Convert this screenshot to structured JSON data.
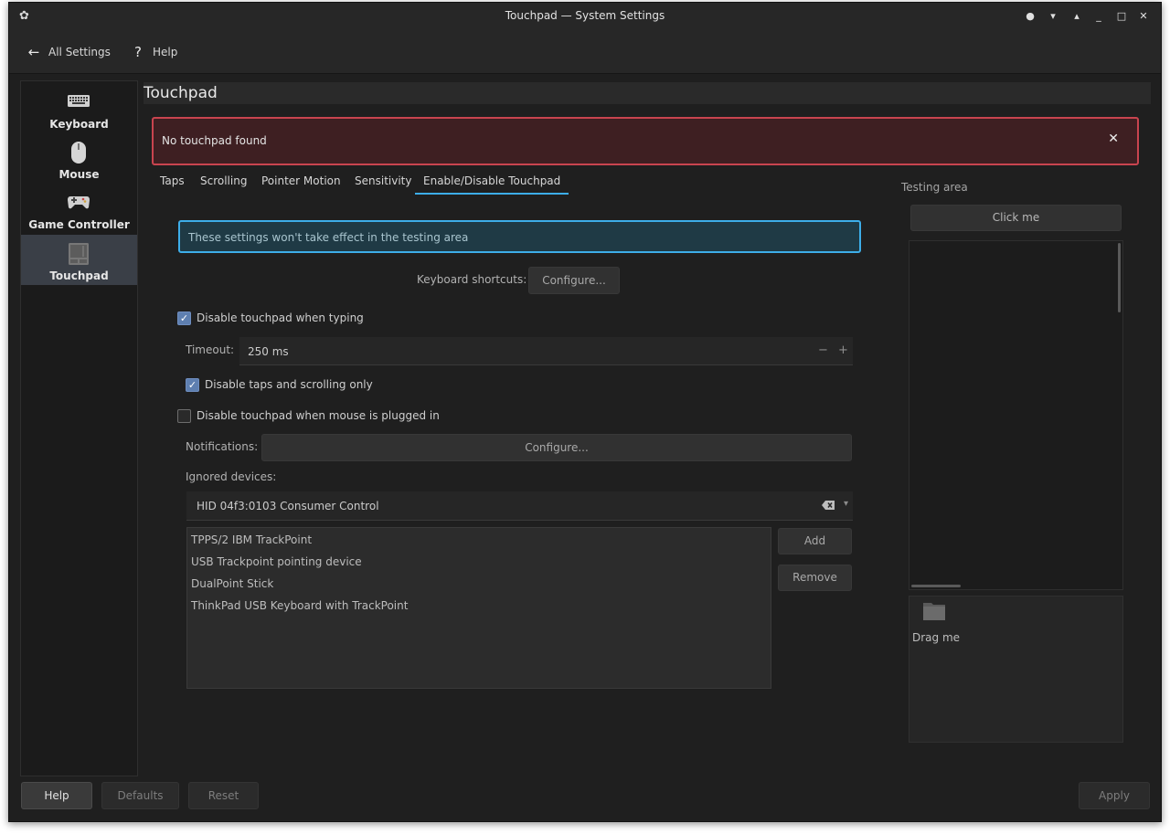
{
  "window": {
    "title": "Touchpad — System Settings",
    "controls": [
      "●",
      "▾",
      "▴",
      "_",
      "□",
      "✕"
    ]
  },
  "toolbar": {
    "back_label": "All Settings",
    "help_label": "Help"
  },
  "sidebar": {
    "items": [
      {
        "label": "Keyboard",
        "icon": "keyboard-icon"
      },
      {
        "label": "Mouse",
        "icon": "mouse-icon"
      },
      {
        "label": "Game Controller",
        "icon": "game-controller-icon"
      },
      {
        "label": "Touchpad",
        "icon": "touchpad-icon",
        "active": true
      }
    ]
  },
  "page": {
    "title": "Touchpad"
  },
  "error": {
    "message": "No touchpad found",
    "close": "✕"
  },
  "tabs": [
    {
      "label": "Taps"
    },
    {
      "label": "Scrolling"
    },
    {
      "label": "Pointer Motion"
    },
    {
      "label": "Sensitivity"
    },
    {
      "label": "Enable/Disable Touchpad",
      "active": true
    }
  ],
  "settings": {
    "info": "These settings won't take effect in the testing area",
    "keyboard_shortcuts_label": "Keyboard shortcuts:",
    "configure_label": "Configure...",
    "disable_typing_label": "Disable touchpad when typing",
    "disable_typing_checked": true,
    "timeout_label": "Timeout:",
    "timeout_value": "250 ms",
    "spin_minus": "−",
    "spin_plus": "+",
    "disable_taps_label": "Disable taps and scrolling only",
    "disable_taps_checked": true,
    "disable_mouse_label": "Disable touchpad when mouse is plugged in",
    "disable_mouse_checked": false,
    "notifications_label": "Notifications:",
    "notifications_configure": "Configure...",
    "ignored_devices_label": "Ignored devices:",
    "combo_value": "HID 04f3:0103 Consumer Control",
    "ignored_devices": [
      "TPPS/2 IBM TrackPoint",
      "USB Trackpoint pointing device",
      "DualPoint Stick",
      "ThinkPad USB Keyboard with TrackPoint"
    ],
    "add_label": "Add",
    "remove_label": "Remove"
  },
  "testing": {
    "title": "Testing area",
    "click_label": "Click me",
    "drag_label": "Drag me"
  },
  "footer": {
    "help_label": "Help",
    "defaults_label": "Defaults",
    "reset_label": "Reset",
    "apply_label": "Apply"
  },
  "colors": {
    "accent": "#3daee9",
    "error_border": "#c9444f",
    "error_bg": "#3e1f22",
    "checkbox": "#5e7fb0",
    "window_bg": "#1f1f1f"
  }
}
